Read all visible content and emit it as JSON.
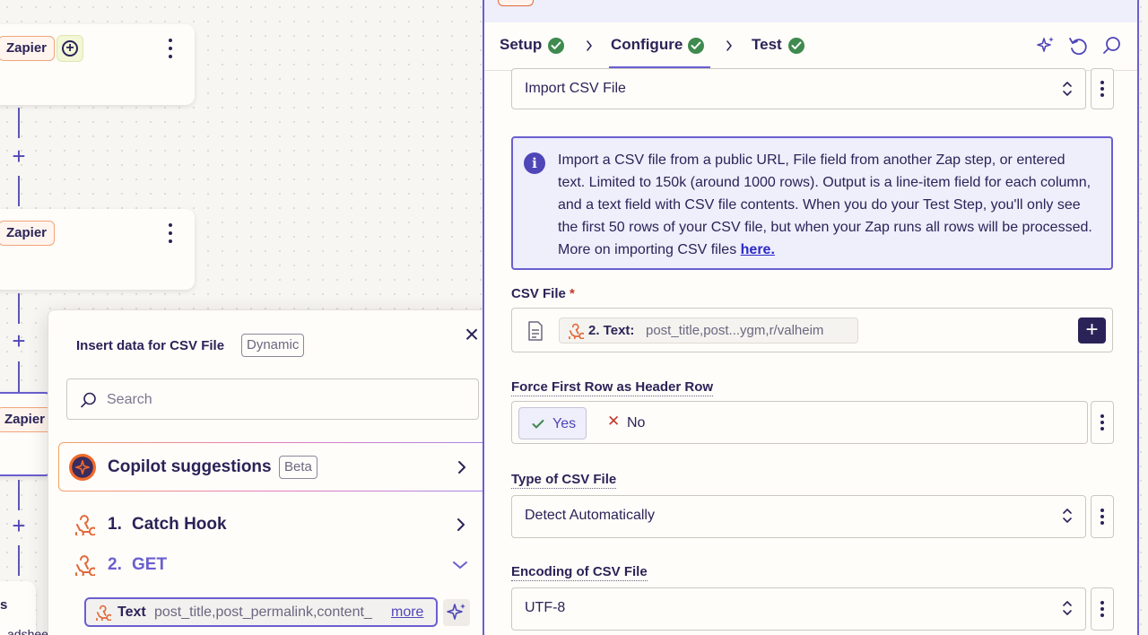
{
  "canvas": {
    "nodes": [
      {
        "app_label": "Zapier"
      },
      {
        "app_label": "Zapier"
      },
      {
        "app_label": "Zapier"
      }
    ],
    "partial_left_text": "s",
    "partial_bottom_text": "adshee"
  },
  "popover": {
    "title": "Insert data for CSV File",
    "title_badge": "Dynamic",
    "search_placeholder": "Search",
    "copilot_label": "Copilot suggestions",
    "copilot_badge": "Beta",
    "steps": [
      {
        "number": "1.",
        "name": "Catch Hook",
        "expanded": false
      },
      {
        "number": "2.",
        "name": "GET",
        "expanded": true
      }
    ],
    "field_pill": {
      "key": "Text",
      "value": "post_title,post_permalink,content_",
      "more_label": "more"
    }
  },
  "panel": {
    "tabs": [
      {
        "label": "Setup",
        "complete": true
      },
      {
        "label": "Configure",
        "complete": true,
        "active": true
      },
      {
        "label": "Test",
        "complete": true
      }
    ],
    "event_select": {
      "value": "Import CSV File"
    },
    "info": {
      "text": "Import a CSV file from a public URL, File field from another Zap step, or entered text. Limited to 150k (around 1000 rows). Output is a line-item field for each column, and a text field with CSV file contents. When you do your Test Step, you'll only see the first 50 rows of your CSV file, but when your Zap runs all rows will be processed. More on importing CSV files ",
      "link_text": "here."
    },
    "csv_file": {
      "label": "CSV File",
      "required_mark": "*",
      "chip_key": "2. Text:",
      "chip_value": "post_title,post...ygm,r/valheim"
    },
    "force_header": {
      "label": "Force First Row as Header Row",
      "yes_label": "Yes",
      "no_label": "No",
      "selected": "Yes"
    },
    "csv_type": {
      "label": "Type of CSV File",
      "value": "Detect Automatically"
    },
    "encoding": {
      "label": "Encoding of CSV File",
      "value": "UTF-8"
    }
  },
  "colors": {
    "accent": "#6a5fd0",
    "brand_dark": "#2b2358",
    "success": "#3f8a4f",
    "zapier_orange": "#f0a57a",
    "link": "#2a2ac8"
  }
}
